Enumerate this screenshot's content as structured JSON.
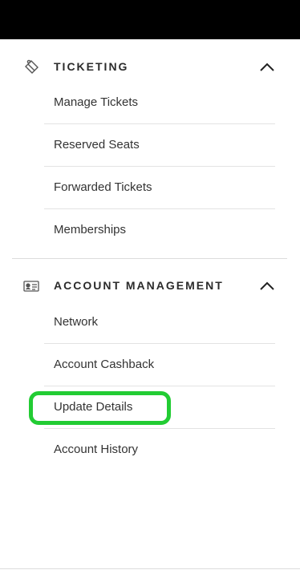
{
  "ticketing": {
    "title": "TICKETING",
    "icon": "ticket-icon",
    "expanded": true,
    "items": [
      {
        "label": "Manage Tickets"
      },
      {
        "label": "Reserved Seats"
      },
      {
        "label": "Forwarded Tickets"
      },
      {
        "label": "Memberships"
      }
    ]
  },
  "account_management": {
    "title": "ACCOUNT MANAGEMENT",
    "icon": "id-card-icon",
    "expanded": true,
    "items": [
      {
        "label": "Network"
      },
      {
        "label": "Account Cashback"
      },
      {
        "label": "Update Details",
        "highlighted": true
      },
      {
        "label": "Account History"
      }
    ]
  },
  "colors": {
    "top_bar": "#000000",
    "highlight": "#22cc33",
    "text": "#333333"
  }
}
